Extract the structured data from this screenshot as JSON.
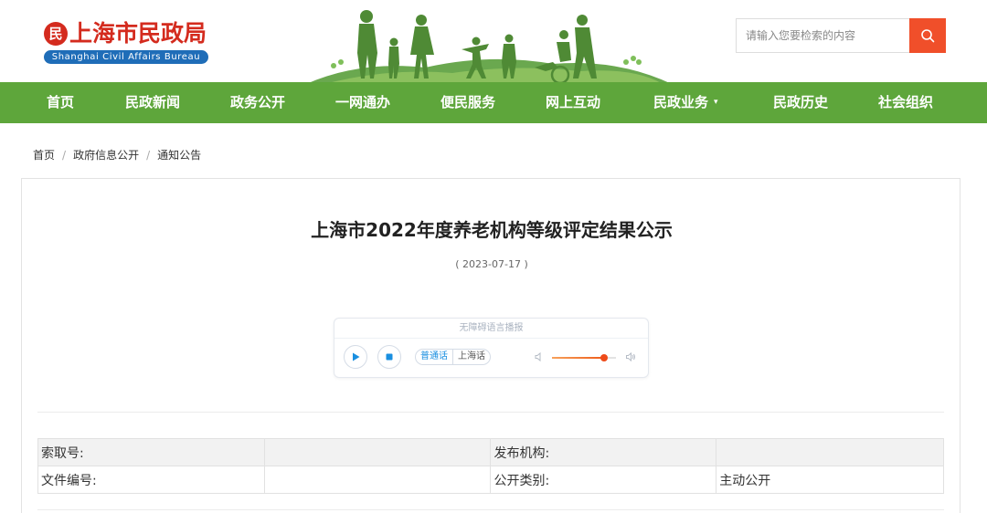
{
  "site": {
    "logo_cn": "上海市民政局",
    "logo_en": "Shanghai Civil Affairs Bureau",
    "emblem_glyph": "民"
  },
  "search": {
    "placeholder": "请输入您要检索的内容",
    "button_color": "#f04f2a",
    "icon": "search-icon"
  },
  "nav": {
    "background": "#5ea63b",
    "items": [
      "首页",
      "民政新闻",
      "政务公开",
      "一网通办",
      "便民服务",
      "网上互动",
      "民政业务",
      "民政历史",
      "社会组织"
    ],
    "dropdown_caret": "▾"
  },
  "breadcrumb": {
    "items": [
      "首页",
      "政府信息公开",
      "通知公告"
    ],
    "separator": "/"
  },
  "article": {
    "title": "上海市2022年度养老机构等级评定结果公示",
    "date": "( 2023-07-17 )"
  },
  "player": {
    "title": "无障碍语言播报",
    "lang_active": "普通话",
    "lang_other": "上海话",
    "volume": 0.82,
    "accent": "#1a8fe0"
  },
  "meta": {
    "rows": [
      [
        "索取号:",
        "",
        "发布机构:",
        ""
      ],
      [
        "文件编号:",
        "",
        "公开类别:",
        "主动公开"
      ]
    ]
  }
}
